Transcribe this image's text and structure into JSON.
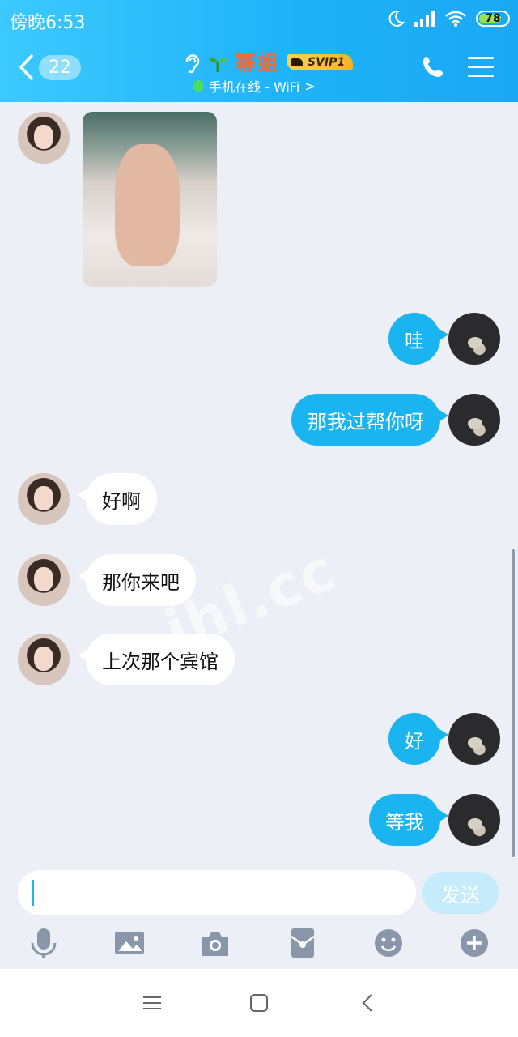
{
  "status": {
    "time": "傍晚6:53",
    "battery": "78",
    "battery_level": 0.78
  },
  "header": {
    "unread_count": "22",
    "contact_name": "幂姐",
    "vip_label": "SVIP1",
    "online_status": "手机在线 - WiFi",
    "status_chevron": ">"
  },
  "messages": [
    {
      "from": "contact",
      "type": "image"
    },
    {
      "from": "me",
      "type": "text",
      "text": "哇"
    },
    {
      "from": "me",
      "type": "text",
      "text": "那我过帮你呀"
    },
    {
      "from": "contact",
      "type": "text",
      "text": "好啊"
    },
    {
      "from": "contact",
      "type": "text",
      "text": "那你来吧"
    },
    {
      "from": "contact",
      "type": "text",
      "text": "上次那个宾馆"
    },
    {
      "from": "me",
      "type": "text",
      "text": "好"
    },
    {
      "from": "me",
      "type": "text",
      "text": "等我"
    }
  ],
  "watermark": "ihl.cc",
  "composer": {
    "input_value": "",
    "send_label": "发送"
  },
  "toolbar": [
    "microphone-icon",
    "image-icon",
    "camera-icon",
    "red-packet-icon",
    "emoji-icon",
    "plus-icon"
  ],
  "colors": {
    "header": "#1fb3f7",
    "outgoing_bubble": "#1ab4f0",
    "background": "#eceff6",
    "contact_name": "#f06a3c"
  }
}
